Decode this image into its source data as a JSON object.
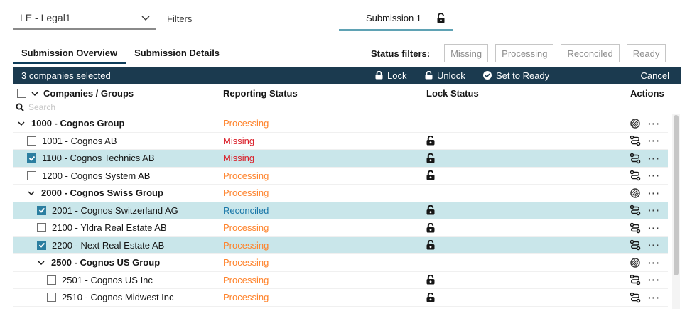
{
  "entity_select": {
    "value": "LE - Legal1"
  },
  "filters_label": "Filters",
  "submission_tab": {
    "label": "Submission 1",
    "icon": "unlock-icon"
  },
  "tabs": [
    {
      "label": "Submission Overview",
      "active": true
    },
    {
      "label": "Submission Details",
      "active": false
    }
  ],
  "status_filters": {
    "label": "Status filters:",
    "buttons": [
      "Missing",
      "Processing",
      "Reconciled",
      "Ready"
    ]
  },
  "action_bar": {
    "selected_text": "3 companies selected",
    "lock": "Lock",
    "unlock": "Unlock",
    "set_ready": "Set to Ready",
    "cancel": "Cancel"
  },
  "table": {
    "headers": {
      "companies": "Companies / Groups",
      "reporting_status": "Reporting Status",
      "lock_status": "Lock Status",
      "actions": "Actions"
    },
    "search_placeholder": "Search",
    "rows": [
      {
        "name": "1000 - Cognos Group",
        "status": "Processing",
        "group": true,
        "level": 0,
        "checkbox": false,
        "checked": false,
        "lock": false,
        "action_icon": "blocked-icon"
      },
      {
        "name": "1001 - Cognos AB",
        "status": "Missing",
        "group": false,
        "level": 1,
        "checkbox": true,
        "checked": false,
        "lock": true,
        "action_icon": "flow-icon"
      },
      {
        "name": "1100 - Cognos Technics AB",
        "status": "Missing",
        "group": false,
        "level": 1,
        "checkbox": true,
        "checked": true,
        "lock": true,
        "action_icon": "flow-icon"
      },
      {
        "name": "1200 - Cognos System AB",
        "status": "Processing",
        "group": false,
        "level": 1,
        "checkbox": true,
        "checked": false,
        "lock": true,
        "action_icon": "flow-icon"
      },
      {
        "name": "2000 - Cognos Swiss Group",
        "status": "Processing",
        "group": true,
        "level": 1,
        "checkbox": false,
        "checked": false,
        "lock": false,
        "action_icon": "blocked-icon"
      },
      {
        "name": "2001 - Cognos Switzerland AG",
        "status": "Reconciled",
        "group": false,
        "level": 2,
        "checkbox": true,
        "checked": true,
        "lock": true,
        "action_icon": "flow-icon"
      },
      {
        "name": "2100 - Yldra Real Estate AB",
        "status": "Processing",
        "group": false,
        "level": 2,
        "checkbox": true,
        "checked": false,
        "lock": true,
        "action_icon": "flow-icon"
      },
      {
        "name": "2200 - Next Real Estate AB",
        "status": "Processing",
        "group": false,
        "level": 2,
        "checkbox": true,
        "checked": true,
        "lock": true,
        "action_icon": "flow-icon"
      },
      {
        "name": "2500 - Cognos US Group",
        "status": "Processing",
        "group": true,
        "level": 2,
        "checkbox": false,
        "checked": false,
        "lock": false,
        "action_icon": "blocked-icon"
      },
      {
        "name": "2501 - Cognos US Inc",
        "status": "Processing",
        "group": false,
        "level": 3,
        "checkbox": true,
        "checked": false,
        "lock": true,
        "action_icon": "flow-icon"
      },
      {
        "name": "2510 - Cognos Midwest Inc",
        "status": "Processing",
        "group": false,
        "level": 3,
        "checkbox": true,
        "checked": false,
        "lock": true,
        "action_icon": "flow-icon"
      }
    ]
  },
  "colors": {
    "action_bar_bg": "#1b3a4f",
    "selected_row": "#c9e6ea",
    "processing": "#ff832b",
    "missing": "#da1e28",
    "reconciled": "#1976a8"
  }
}
